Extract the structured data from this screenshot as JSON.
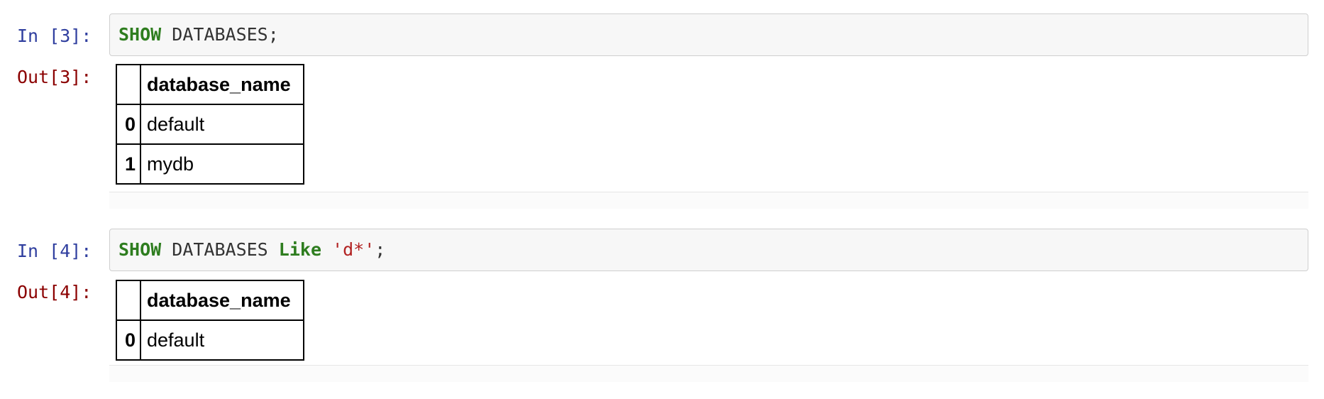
{
  "cells": [
    {
      "in_prompt": "In [3]:",
      "code": {
        "kw1": "SHOW",
        "text1": " DATABASES;"
      },
      "out_prompt": "Out[3]:",
      "table": {
        "column": "database_name",
        "rows": [
          {
            "index": "0",
            "value": "default"
          },
          {
            "index": "1",
            "value": "mydb"
          }
        ]
      }
    },
    {
      "in_prompt": "In [4]:",
      "code": {
        "kw1": "SHOW",
        "text1": " DATABASES ",
        "kw2": "Like",
        "text2": " ",
        "str1": "'d*'",
        "text3": ";"
      },
      "out_prompt": "Out[4]:",
      "table": {
        "column": "database_name",
        "rows": [
          {
            "index": "0",
            "value": "default"
          }
        ]
      }
    }
  ],
  "colors": {
    "in_prompt": "#303f9f",
    "out_prompt": "#8b0000",
    "keyword": "#2e7d1f",
    "string": "#b22222",
    "input_bg": "#f7f7f7"
  }
}
